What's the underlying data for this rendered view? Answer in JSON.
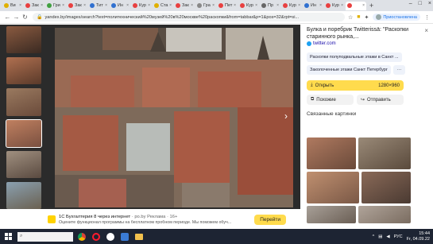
{
  "tabs": [
    {
      "label": "Ви",
      "color": "#e0b000"
    },
    {
      "label": "Зак",
      "color": "#e84040"
    },
    {
      "label": "Гри",
      "color": "#40a040"
    },
    {
      "label": "Зак",
      "color": "#e84040"
    },
    {
      "label": "Тит",
      "color": "#3070d0"
    },
    {
      "label": "Ин",
      "color": "#3070d0"
    },
    {
      "label": "Кур",
      "color": "#e84040"
    },
    {
      "label": "Ста",
      "color": "#e0b000"
    },
    {
      "label": "Зак",
      "color": "#e84040"
    },
    {
      "label": "Гра",
      "color": "#888888"
    },
    {
      "label": "Пет",
      "color": "#e84040"
    },
    {
      "label": "Кур",
      "color": "#e84040"
    },
    {
      "label": "Пр",
      "color": "#666666"
    },
    {
      "label": "Кур",
      "color": "#e84040"
    },
    {
      "label": "Ин",
      "color": "#3070d0"
    },
    {
      "label": "Кур",
      "color": "#e84040"
    },
    {
      "label": "",
      "color": "#e84040"
    }
  ],
  "address": {
    "url": "yandex.by/images/search?text=политехнический%20музей%20в%20москве%20раскопки&from=tabbar&p=1&pos=32&rpt=si..."
  },
  "profile": {
    "label": "Приостановлена"
  },
  "side": {
    "title": "Булка и поребрик Twitterissä: \"Раскопки старинного рынка,...",
    "source": "twitter.com",
    "chips": [
      "Раскопки полуподвальные этажи в Санкт ...",
      "Заколоченные этажи Санкт Петербург"
    ],
    "more": "···",
    "open_label": "Открыть",
    "resolution": "1280×960",
    "similar_label": "Похожие",
    "share_label": "Отправить",
    "related_title": "Связанные картинки"
  },
  "ad": {
    "title": "1С Бухгалтерия 8 через интернет",
    "domain": "· po.by",
    "tag": "Реклама · 16+",
    "text": "Оцените функционал программы на бесплатном пробном периоде. Мы поможем обуч...",
    "button": "Перейти"
  },
  "taskbar": {
    "lang": "РУС",
    "time": "15:44",
    "date": "Fr, 04.09.22"
  },
  "colors": {
    "yandex_yellow": "#ffdb4d",
    "link_blue": "#1a0dab",
    "viewer_bg": "#2b2b2b"
  }
}
